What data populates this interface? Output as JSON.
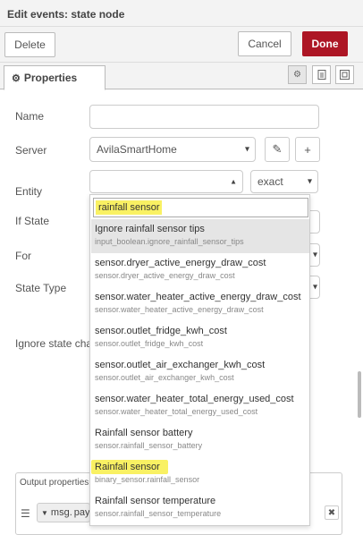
{
  "header": {
    "title": "Edit events: state node"
  },
  "toolbar": {
    "delete_label": "Delete",
    "cancel_label": "Cancel",
    "done_label": "Done"
  },
  "tabs": {
    "properties_label": "Properties"
  },
  "form": {
    "name_label": "Name",
    "name_value": "",
    "server_label": "Server",
    "server_value": "AvilaSmartHome",
    "entity_label": "Entity",
    "entity_value": "",
    "match_value": "exact",
    "ifstate_label": "If State",
    "for_label": "For",
    "statetype_label": "State Type",
    "ignore_label": "Ignore state changes if"
  },
  "dropdown": {
    "search_value": "rainfall sensor",
    "options": [
      {
        "name": "Ignore rainfall sensor tips",
        "id": "input_boolean.ignore_rainfall_sensor_tips"
      },
      {
        "name": "sensor.dryer_active_energy_draw_cost",
        "id": "sensor.dryer_active_energy_draw_cost"
      },
      {
        "name": "sensor.water_heater_active_energy_draw_cost",
        "id": "sensor.water_heater_active_energy_draw_cost"
      },
      {
        "name": "sensor.outlet_fridge_kwh_cost",
        "id": "sensor.outlet_fridge_kwh_cost"
      },
      {
        "name": "sensor.outlet_air_exchanger_kwh_cost",
        "id": "sensor.outlet_air_exchanger_kwh_cost"
      },
      {
        "name": "sensor.water_heater_total_energy_used_cost",
        "id": "sensor.water_heater_total_energy_used_cost"
      },
      {
        "name": "Rainfall sensor battery",
        "id": "sensor.rainfall_sensor_battery"
      },
      {
        "name": "Rainfall sensor",
        "id": "binary_sensor.rainfall_sensor"
      },
      {
        "name": "Rainfall sensor temperature",
        "id": "sensor.rainfall_sensor_temperature"
      }
    ]
  },
  "output": {
    "legend": "Output properties",
    "msg_label": "msg.",
    "value_partial": "pay"
  },
  "colors": {
    "done": "#ad1625",
    "highlight": "#f9f163"
  }
}
